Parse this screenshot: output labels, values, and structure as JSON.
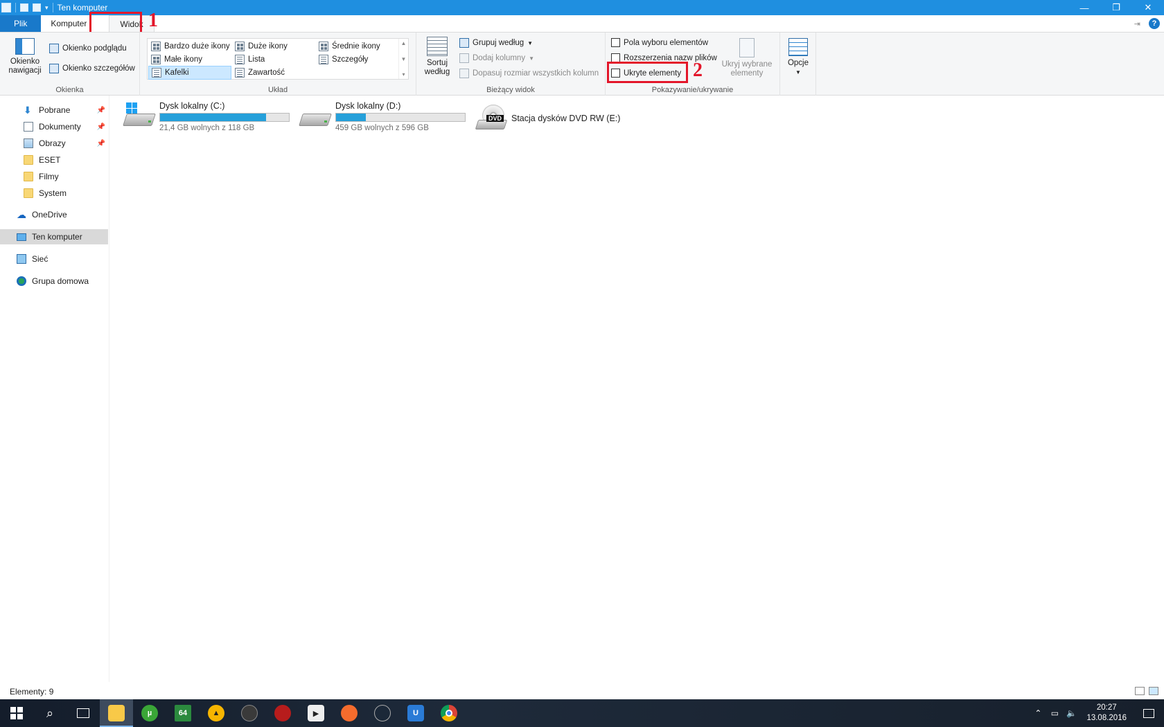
{
  "window": {
    "title": "Ten komputer",
    "controls": {
      "minimize": "—",
      "restore": "❐",
      "close": "✕"
    }
  },
  "tabs": [
    {
      "label": "Plik"
    },
    {
      "label": "Komputer"
    },
    {
      "label": "Widok"
    }
  ],
  "annotations": {
    "one": "1",
    "two": "2"
  },
  "ribbon": {
    "okienka": {
      "label": "Okienka",
      "nav_pane": "Okienko nawigacji",
      "preview_pane": "Okienko podglądu",
      "details_pane": "Okienko szczegółów"
    },
    "uklad": {
      "label": "Układ",
      "items": [
        "Bardzo duże ikony",
        "Duże ikony",
        "Średnie ikony",
        "Małe ikony",
        "Lista",
        "Szczegóły",
        "Kafelki",
        "Zawartość"
      ],
      "selected": "Kafelki"
    },
    "biezacy": {
      "label": "Bieżący widok",
      "sort": "Sortuj według",
      "group": "Grupuj według",
      "add_columns": "Dodaj kolumny",
      "fit_columns": "Dopasuj rozmiar wszystkich kolumn"
    },
    "pokazywanie": {
      "label": "Pokazywanie/ukrywanie",
      "checkboxes": "Pola wyboru elementów",
      "extensions": "Rozszerzenia nazw plików",
      "hidden": "Ukryte elementy",
      "hide_selected": "Ukryj wybrane elementy"
    },
    "options": "Opcje"
  },
  "nav": {
    "pinned": [
      {
        "label": "Pobrane"
      },
      {
        "label": "Dokumenty"
      },
      {
        "label": "Obrazy"
      }
    ],
    "folders": [
      {
        "label": "ESET"
      },
      {
        "label": "Filmy"
      },
      {
        "label": "System"
      }
    ],
    "onedrive": "OneDrive",
    "this_pc": "Ten komputer",
    "network": "Sieć",
    "homegroup": "Grupa domowa"
  },
  "drives": [
    {
      "name": "Dysk lokalny (C:)",
      "free": "21,4 GB wolnych z 118 GB",
      "used_fraction": 0.82
    },
    {
      "name": "Dysk lokalny (D:)",
      "free": "459 GB wolnych z 596 GB",
      "used_fraction": 0.23
    },
    {
      "name": "Stacja dysków DVD RW (E:)",
      "badge": "DVD"
    }
  ],
  "status": {
    "items": "Elementy: 9"
  },
  "taskbar": {
    "app_64": "64",
    "time": "20:27",
    "date": "13.08.2016"
  },
  "colors": {
    "titlebar": "#1f8fe0",
    "file_tab": "#1979ca",
    "highlight": "#e3162a",
    "progress": "#26a0da"
  }
}
